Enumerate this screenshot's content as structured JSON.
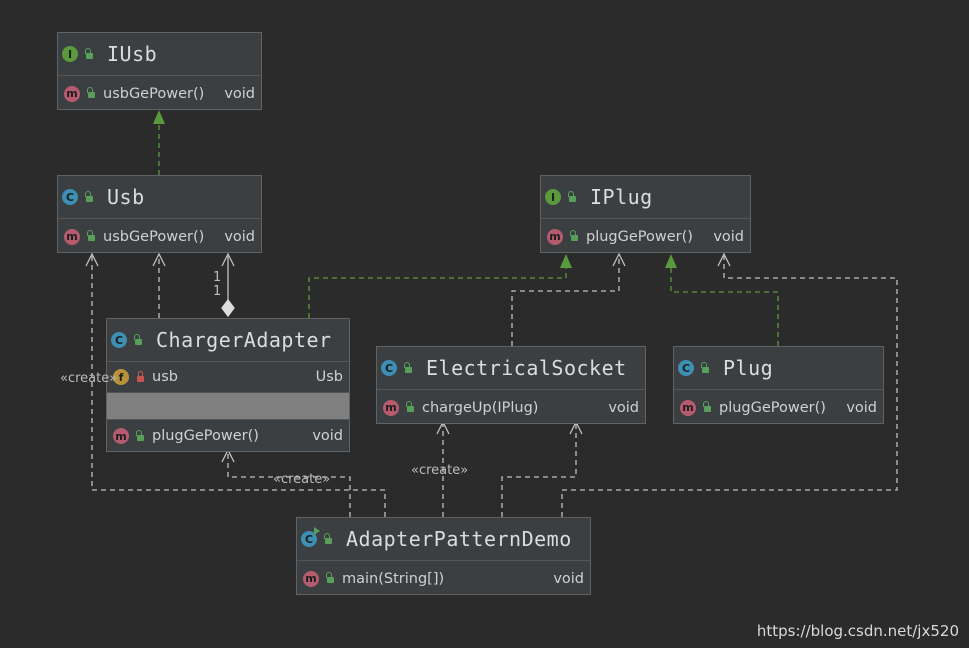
{
  "diagram": {
    "nodes": {
      "iusb": {
        "title": "IUsb",
        "kind": "i",
        "methods": [
          {
            "name": "usbGePower()",
            "type": "void"
          }
        ]
      },
      "usb": {
        "title": "Usb",
        "kind": "c",
        "methods": [
          {
            "name": "usbGePower()",
            "type": "void"
          }
        ]
      },
      "iplug": {
        "title": "IPlug",
        "kind": "i",
        "methods": [
          {
            "name": "plugGePower()",
            "type": "void"
          }
        ]
      },
      "charger_adapter": {
        "title": "ChargerAdapter",
        "kind": "c",
        "fields": [
          {
            "name": "usb",
            "type": "Usb"
          }
        ],
        "methods": [
          {
            "name": "plugGePower()",
            "type": "void"
          }
        ]
      },
      "electrical_socket": {
        "title": "ElectricalSocket",
        "kind": "c",
        "methods": [
          {
            "name": "chargeUp(IPlug)",
            "type": "void"
          }
        ]
      },
      "plug": {
        "title": "Plug",
        "kind": "c",
        "methods": [
          {
            "name": "plugGePower()",
            "type": "void"
          }
        ]
      },
      "adapter_pattern_demo": {
        "title": "AdapterPatternDemo",
        "kind": "c",
        "methods": [
          {
            "name": "main(String[])",
            "type": "void"
          }
        ]
      }
    },
    "badges": {
      "interface": "I",
      "class": "C",
      "method": "m",
      "field": "f"
    },
    "edge_labels": {
      "create_left": "«create»",
      "create_bottom": "«create»",
      "create_middle": "«create»",
      "multiplicity_top": "1",
      "multiplicity_bottom": "1"
    },
    "colors": {
      "background": "#2b2b2b",
      "node_fill": "#3c3f41",
      "implements": "#5a9a3c",
      "dependency": "#c0c0c0",
      "interface_badge": "#5a9a3c",
      "class_badge": "#3d8fb3",
      "method_badge": "#b65b6e",
      "field_badge": "#b8933b"
    },
    "icons": {
      "public": "unlocked-icon",
      "private": "locked-icon",
      "runnable": "run-icon"
    }
  },
  "watermark": "https://blog.csdn.net/jx520"
}
